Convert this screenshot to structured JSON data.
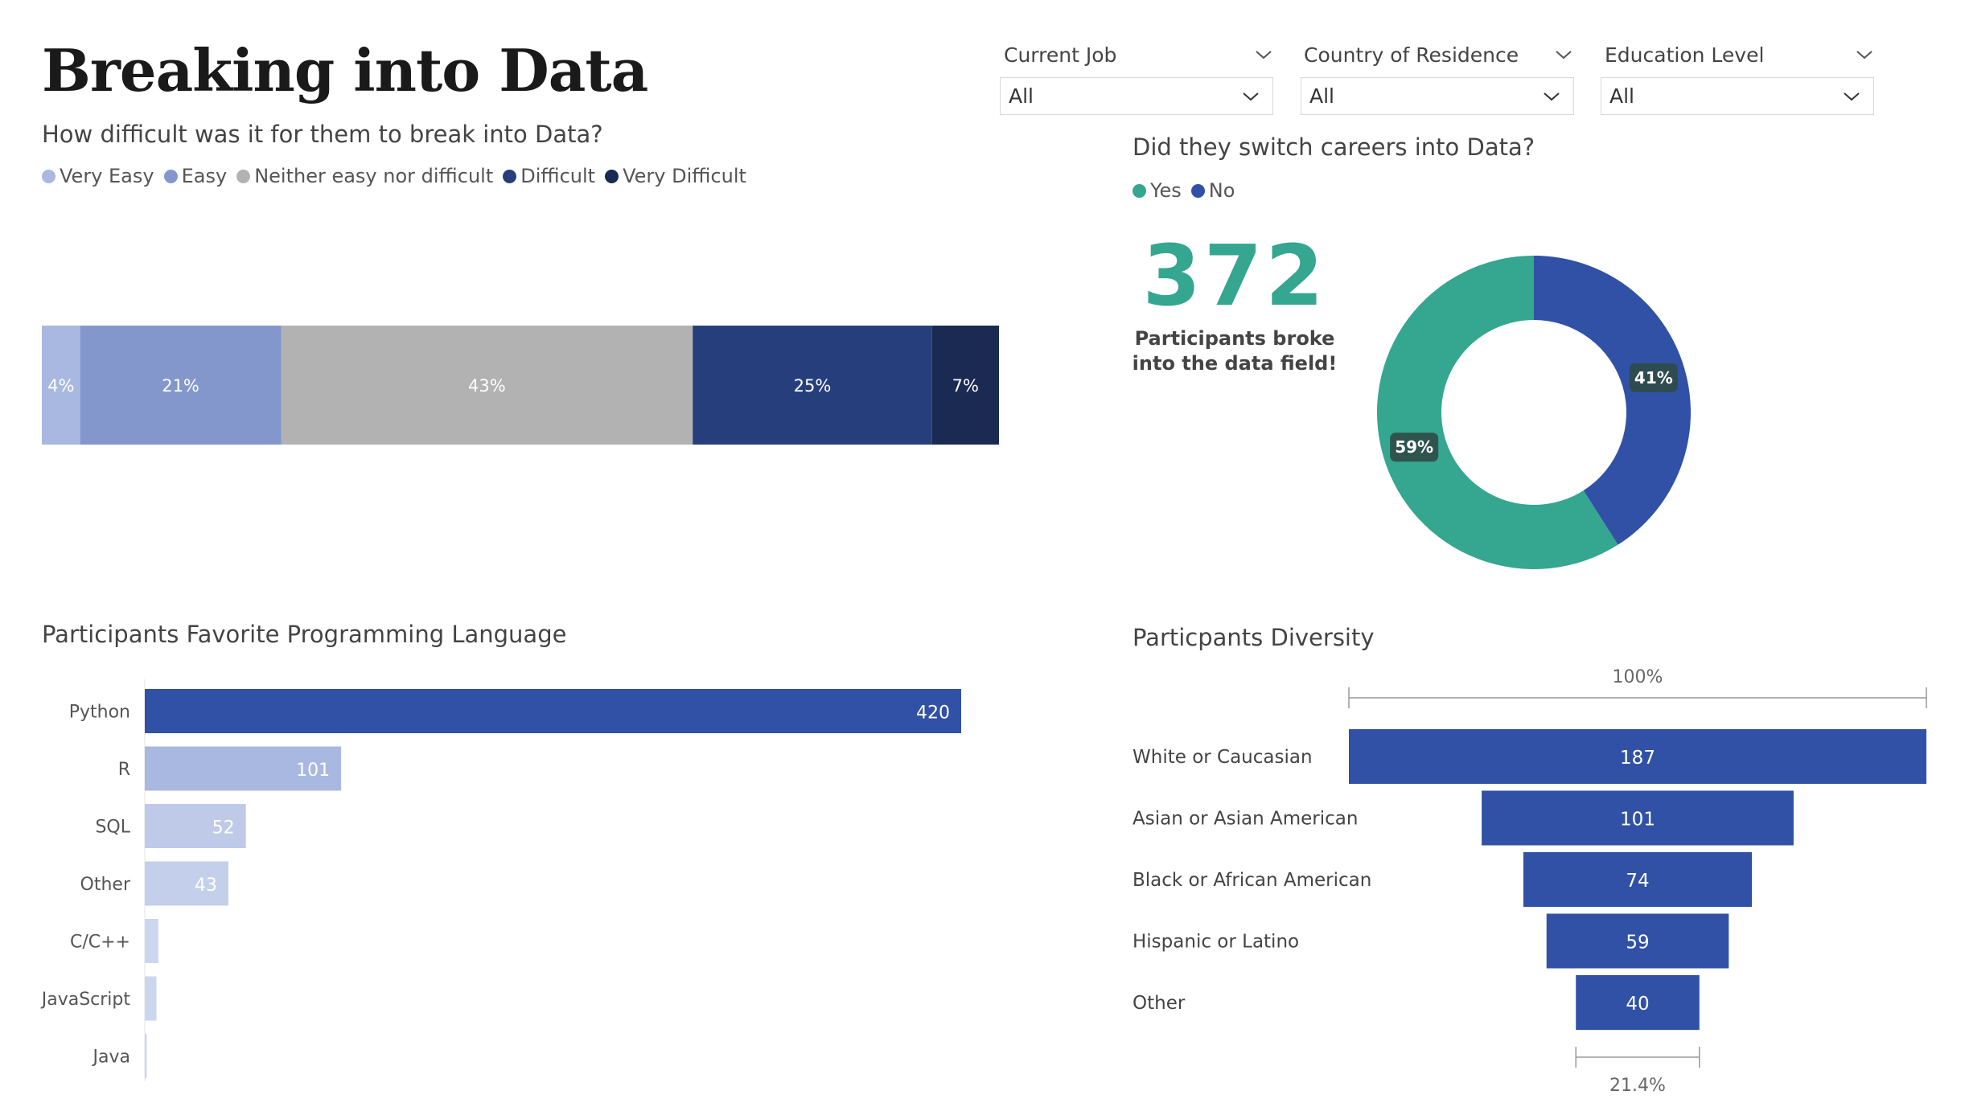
{
  "header": {
    "title": "Breaking into Data"
  },
  "filters": [
    {
      "label": "Current Job",
      "value": "All"
    },
    {
      "label": "Country of Residence",
      "value": "All"
    },
    {
      "label": "Education Level",
      "value": "All"
    }
  ],
  "difficulty": {
    "subtitle": "How difficult was it for them to break into Data?"
  },
  "switch": {
    "subtitle": "Did they switch careers into Data?",
    "kpi_value": "372",
    "kpi_label_line1": "Participants broke",
    "kpi_label_line2": "into the data field!"
  },
  "languages": {
    "subtitle": "Participants Favorite Programming Language"
  },
  "diversity": {
    "subtitle": "Particpants Diversity"
  },
  "colors": {
    "very_easy": "#a9b8e0",
    "easy": "#8497cd",
    "neither": "#b2b2b2",
    "difficult": "#263f7c",
    "very_difficult": "#1a2a52",
    "yes": "#35a68f",
    "no": "#3151a6",
    "python": "#3151a6",
    "light_blue": "#a9b8e0"
  },
  "chart_data": [
    {
      "type": "bar",
      "orientation": "horizontal-stacked-100",
      "title": "How difficult was it for them to break into Data?",
      "series": [
        {
          "name": "Very Easy",
          "value": 4,
          "label": "4%",
          "color": "#a9b8e0"
        },
        {
          "name": "Easy",
          "value": 21,
          "label": "21%",
          "color": "#8497cd"
        },
        {
          "name": "Neither easy nor difficult",
          "value": 43,
          "label": "43%",
          "color": "#b2b2b2"
        },
        {
          "name": "Difficult",
          "value": 25,
          "label": "25%",
          "color": "#263f7c"
        },
        {
          "name": "Very Difficult",
          "value": 7,
          "label": "7%",
          "color": "#1a2a52"
        }
      ],
      "legend": "top-left"
    },
    {
      "type": "pie",
      "variant": "donut",
      "title": "Did they switch careers into Data?",
      "slices": [
        {
          "name": "Yes",
          "value": 59,
          "label": "59%",
          "color": "#35a68f"
        },
        {
          "name": "No",
          "value": 41,
          "label": "41%",
          "color": "#3151a6"
        }
      ],
      "legend": "top-left"
    },
    {
      "type": "bar",
      "orientation": "horizontal",
      "title": "Participants Favorite Programming Language",
      "categories": [
        "Python",
        "R",
        "SQL",
        "Other",
        "C/C++",
        "JavaScript",
        "Java"
      ],
      "values": [
        420,
        101,
        52,
        43,
        7,
        6,
        1
      ],
      "labels": [
        "420",
        "101",
        "52",
        "43",
        "",
        "",
        ""
      ],
      "colors": [
        "#3151a6",
        "#a9b8e0",
        "#bfcae9",
        "#c4cfeb",
        "#cdd6ef",
        "#cdd6ef",
        "#cdd6ef"
      ],
      "xlim": [
        0,
        420
      ]
    },
    {
      "type": "bar",
      "variant": "funnel",
      "title": "Particpants Diversity",
      "categories": [
        "White or Caucasian",
        "Asian or Asian American",
        "Black or African American",
        "Hispanic or Latino",
        "Other"
      ],
      "values": [
        187,
        101,
        74,
        59,
        40
      ],
      "labels": [
        "187",
        "101",
        "74",
        "59",
        "40"
      ],
      "top_percent_label": "100%",
      "bottom_percent_label": "21.4%",
      "color": "#3151a6"
    }
  ]
}
